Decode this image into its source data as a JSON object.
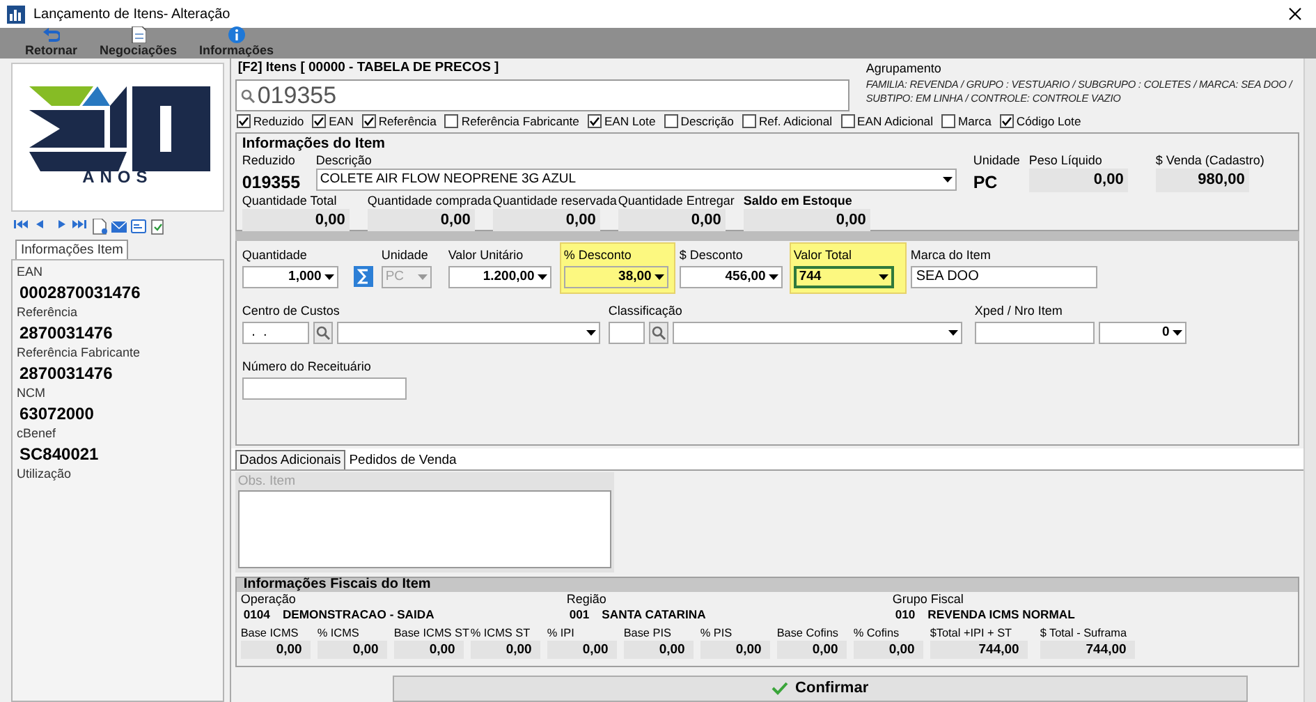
{
  "window": {
    "title": "Lançamento de Itens- Alteração"
  },
  "toolbar": [
    {
      "label": "Retornar"
    },
    {
      "label": "Negociações"
    },
    {
      "label": "Informações"
    }
  ],
  "logo": {
    "caption": "ANOS"
  },
  "side_tabs": [
    {
      "label": "Informações Item",
      "selected": true
    }
  ],
  "side_info": [
    {
      "label": "EAN",
      "value": "0002870031476"
    },
    {
      "label": "Referência",
      "value": "2870031476"
    },
    {
      "label": "Referência Fabricante",
      "value": "2870031476"
    },
    {
      "label": "NCM",
      "value": "63072000"
    },
    {
      "label": "cBenef",
      "value": "SC840021"
    },
    {
      "label": "Utilização"
    }
  ],
  "item_search": {
    "title": "[F2] Itens [ 00000 - TABELA DE PRECOS ]",
    "value": "019355"
  },
  "grouping": {
    "label": "Agrupamento",
    "lines": [
      "FAMILIA: REVENDA / GRUPO : VESTUARIO / SUBGRUPO : COLETES / MARCA: SEA DOO /",
      "SUBTIPO: EM LINHA / CONTROLE: CONTROLE VAZIO"
    ]
  },
  "search_options": [
    {
      "label": "Reduzido",
      "checked": true
    },
    {
      "label": "EAN",
      "checked": true
    },
    {
      "label": "Referência",
      "checked": true
    },
    {
      "label": "Referência Fabricante",
      "checked": false
    },
    {
      "label": "EAN Lote",
      "checked": true
    },
    {
      "label": "Descrição",
      "checked": false
    },
    {
      "label": "Ref. Adicional",
      "checked": false
    },
    {
      "label": "EAN Adicional",
      "checked": false
    },
    {
      "label": "Marca",
      "checked": false
    },
    {
      "label": "Código Lote",
      "checked": true
    }
  ],
  "item_info": {
    "title": "Informações do Item",
    "reduced_code": {
      "label": "Reduzido",
      "value": "019355"
    },
    "description": {
      "label": "Descrição",
      "value": "COLETE AIR FLOW NEOPRENE 3G AZUL"
    },
    "unit": {
      "label": "Unidade",
      "value": "PC"
    },
    "net_weight": {
      "label": "Peso Líquido",
      "value": "0,00"
    },
    "sale_price": {
      "label": "$ Venda (Cadastro)",
      "value": "980,00"
    },
    "quantities": [
      {
        "label": "Quantidade Total",
        "value": "0,00",
        "emphasized": false
      },
      {
        "label": "Quantidade comprada",
        "value": "0,00",
        "emphasized": false
      },
      {
        "label": "Quantidade reservada",
        "value": "0,00",
        "emphasized": false
      },
      {
        "label": "Quantidade Entregar",
        "value": "0,00",
        "emphasized": false
      },
      {
        "label": "Saldo em Estoque",
        "value": "0,00",
        "emphasized": true
      }
    ]
  },
  "entry_rows": [
    [
      {
        "label": "Quantidade",
        "highlighted": false,
        "controls": [
          {
            "kind": "number-dropdown",
            "value": "1,000"
          },
          {
            "kind": "sum-button"
          }
        ]
      },
      {
        "label": "Unidade",
        "highlighted": false,
        "controls": [
          {
            "kind": "dropdown",
            "value": "PC",
            "disabled": true
          }
        ]
      },
      {
        "label": "Valor Unitário",
        "highlighted": false,
        "controls": [
          {
            "kind": "number-dropdown",
            "value": "1.200,00"
          }
        ]
      },
      {
        "label": "% Desconto",
        "highlighted": true,
        "controls": [
          {
            "kind": "number-dropdown",
            "value": "38,00"
          }
        ]
      },
      {
        "label": "$ Desconto",
        "highlighted": false,
        "controls": [
          {
            "kind": "number-dropdown",
            "value": "456,00"
          }
        ]
      },
      {
        "label": "Valor Total",
        "highlighted": true,
        "controls": [
          {
            "kind": "dropdown",
            "value": "744",
            "focused": true
          }
        ]
      },
      {
        "label": "Marca do Item",
        "highlighted": false,
        "controls": [
          {
            "kind": "text",
            "value": "SEA DOO"
          }
        ]
      }
    ],
    [
      {
        "label": "Centro de Custos",
        "highlighted": false,
        "controls": [
          {
            "kind": "text",
            "value": " .  ."
          },
          {
            "kind": "search-button"
          },
          {
            "kind": "dropdown"
          }
        ]
      },
      {
        "label": "Classificação",
        "highlighted": false,
        "controls": [
          {
            "kind": "text"
          },
          {
            "kind": "search-button"
          },
          {
            "kind": "dropdown"
          }
        ]
      },
      {
        "label": "Xped / Nro Item",
        "highlighted": false,
        "controls": [
          {
            "kind": "text"
          },
          {
            "kind": "number-dropdown",
            "value": "0"
          }
        ]
      }
    ],
    [
      {
        "label": "Número do Receituário",
        "highlighted": false,
        "controls": [
          {
            "kind": "text"
          }
        ]
      }
    ]
  ],
  "bottom_tabs": [
    {
      "label": "Dados Adicionais",
      "selected": true
    },
    {
      "label": "Pedidos de Venda",
      "selected": false
    }
  ],
  "notes": {
    "label": "Obs. Item"
  },
  "fiscal": {
    "title": "Informações Fiscais do Item",
    "groups": [
      {
        "label": "Operação",
        "code": "0104",
        "name": "DEMONSTRACAO - SAIDA"
      },
      {
        "label": "Região",
        "code": "001",
        "name": "SANTA CATARINA"
      },
      {
        "label": "Grupo Fiscal",
        "code": "010",
        "name": "REVENDA ICMS NORMAL"
      }
    ],
    "taxes": [
      {
        "label": "Base ICMS",
        "value": "0,00"
      },
      {
        "label": "% ICMS",
        "value": "0,00"
      },
      {
        "label": "Base ICMS ST",
        "value": "0,00"
      },
      {
        "label": "% ICMS ST",
        "value": "0,00"
      },
      {
        "label": "% IPI",
        "value": "0,00"
      },
      {
        "label": "Base PIS",
        "value": "0,00"
      },
      {
        "label": "% PIS",
        "value": "0,00"
      },
      {
        "label": "Base Cofins",
        "value": "0,00"
      },
      {
        "label": "% Cofins",
        "value": "0,00"
      },
      {
        "label": "$Total +IPI + ST",
        "value": "744,00"
      },
      {
        "label": "$ Total - Suframa",
        "value": "744,00"
      }
    ]
  },
  "confirm": {
    "label": "Confirmar"
  }
}
